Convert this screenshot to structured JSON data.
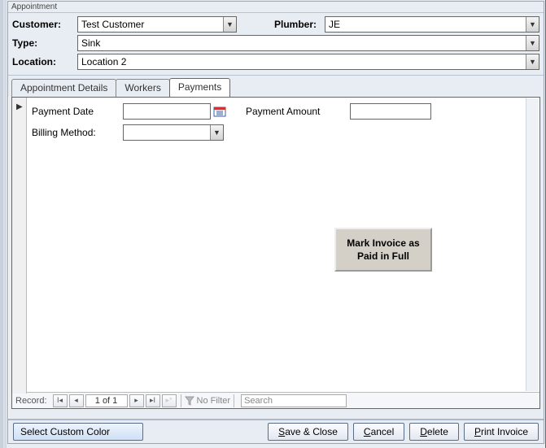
{
  "window": {
    "title": "Appointment"
  },
  "header": {
    "customer": {
      "label": "Customer:",
      "value": "Test Customer"
    },
    "plumber": {
      "label": "Plumber:",
      "value": "JE"
    },
    "type": {
      "label": "Type:",
      "value": "Sink"
    },
    "location": {
      "label": "Location:",
      "value": "Location 2"
    }
  },
  "tabs": {
    "details": "Appointment Details",
    "workers": "Workers",
    "payments": "Payments",
    "active": "payments"
  },
  "payments": {
    "paymentDate": {
      "label": "Payment Date",
      "value": ""
    },
    "paymentAmount": {
      "label": "Payment Amount",
      "value": ""
    },
    "billingMethod": {
      "label": "Billing Method:",
      "value": ""
    },
    "markPaid": {
      "line1": "Mark Invoice as",
      "line2": "Paid in Full"
    }
  },
  "recordNav": {
    "label": "Record:",
    "counter": "1 of 1",
    "noFilter": "No Filter",
    "searchPlaceholder": "Search"
  },
  "footer": {
    "selectCustomColor": "Select Custom Color",
    "saveClose": {
      "pre": "",
      "ul": "S",
      "post": "ave & Close"
    },
    "cancel": {
      "pre": "",
      "ul": "C",
      "post": "ancel"
    },
    "delete": {
      "pre": "",
      "ul": "D",
      "post": "elete"
    },
    "print": {
      "pre": "",
      "ul": "P",
      "post": "rint Invoice"
    }
  }
}
